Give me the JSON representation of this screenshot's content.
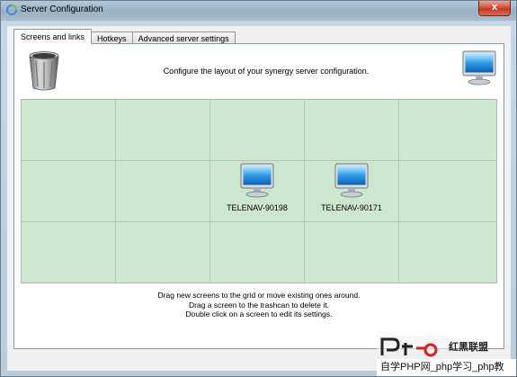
{
  "window": {
    "title": "Server Configuration",
    "close_symbol": "x"
  },
  "tabs": [
    {
      "label": "Screens and links",
      "active": true
    },
    {
      "label": "Hotkeys",
      "active": false
    },
    {
      "label": "Advanced server settings",
      "active": false
    }
  ],
  "panel": {
    "description": "Configure the layout of your synergy server configuration.",
    "icons": {
      "trash": "trash-can-icon",
      "new_screen": "monitor-icon"
    }
  },
  "grid": {
    "rows": 3,
    "columns": 5,
    "background_color": "#cde7cf",
    "screens": [
      {
        "name": "TELENAV-90198",
        "row": 2,
        "column": 3
      },
      {
        "name": "TELENAV-90171",
        "row": 2,
        "column": 4
      }
    ]
  },
  "instructions": [
    "Drag new screens to the grid or move existing ones around.",
    "Drag a screen to the trashcan to delete it.",
    "Double click on a screen to edit its settings."
  ],
  "watermark": {
    "chinese_title": "红黑联盟",
    "text": "自学PHP网_php学习_php教"
  }
}
